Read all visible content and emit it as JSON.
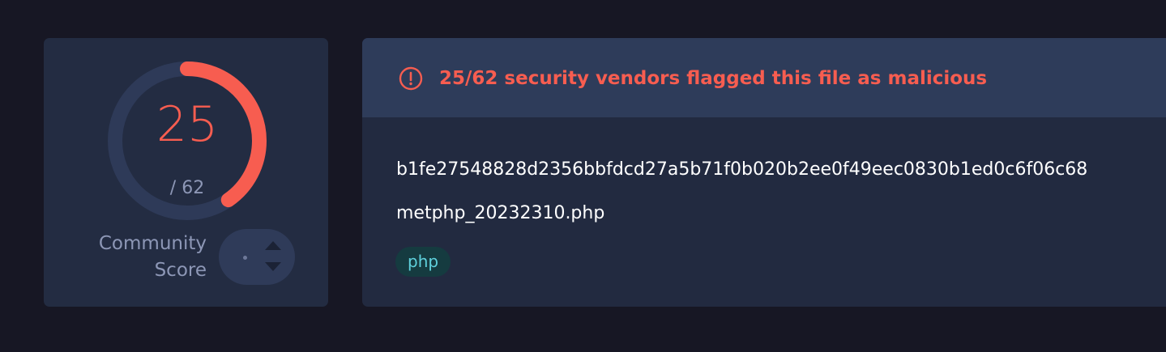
{
  "score": {
    "detections": "25",
    "total_label": "/ 62",
    "detection_fraction": 0.4032,
    "community_label_line1": "Community",
    "community_label_line2": "Score",
    "ring_color": "#f75d50",
    "track_color": "#2e3a58"
  },
  "detection": {
    "alert_icon": "exclamation-circle-icon",
    "alert_text": "25/62 security vendors flagged this file as malicious",
    "file_hash": "b1fe27548828d2356bbfdcd27a5b71f0b020b2ee0f49eec0830b1ed0c6f06c68",
    "file_name": "metphp_20232310.php",
    "tags": [
      "php"
    ]
  },
  "icons": {
    "vote_up": "triangle-up-icon",
    "vote_down": "triangle-down-icon"
  }
}
